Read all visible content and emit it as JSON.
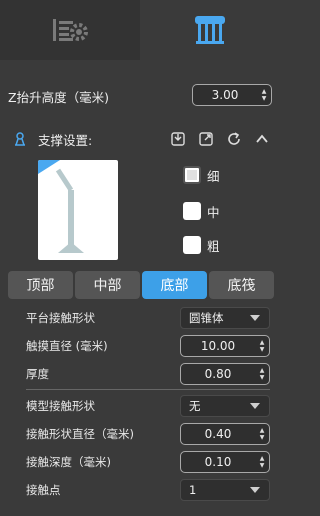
{
  "topbar": {
    "tabs": [
      {
        "name": "settings"
      },
      {
        "name": "support"
      }
    ]
  },
  "lift": {
    "label": "Z抬升高度（毫米)",
    "value": "3.00"
  },
  "support": {
    "title": "支撑设置:",
    "sizes": [
      {
        "label": "细",
        "checked": true
      },
      {
        "label": "中",
        "checked": false
      },
      {
        "label": "粗",
        "checked": false
      }
    ],
    "tabs": [
      "顶部",
      "中部",
      "底部",
      "底筏"
    ],
    "active_tab": "底部"
  },
  "bottom": {
    "platform_shape": {
      "label": "平台接触形状",
      "value": "圆锥体"
    },
    "contact_diameter": {
      "label": "触摸直径 (毫米)",
      "value": "10.00"
    },
    "thickness": {
      "label": "厚度",
      "value": "0.80"
    },
    "model_shape": {
      "label": "模型接触形状",
      "value": "无"
    },
    "model_diameter": {
      "label": "接触形状直径（毫米)",
      "value": "0.40"
    },
    "contact_depth": {
      "label": "接触深度（毫米)",
      "value": "0.10"
    },
    "contact_points": {
      "label": "接触点",
      "value": "1"
    }
  },
  "colors": {
    "accent": "#3da0e8",
    "preview_model": "#b7c9cc"
  }
}
